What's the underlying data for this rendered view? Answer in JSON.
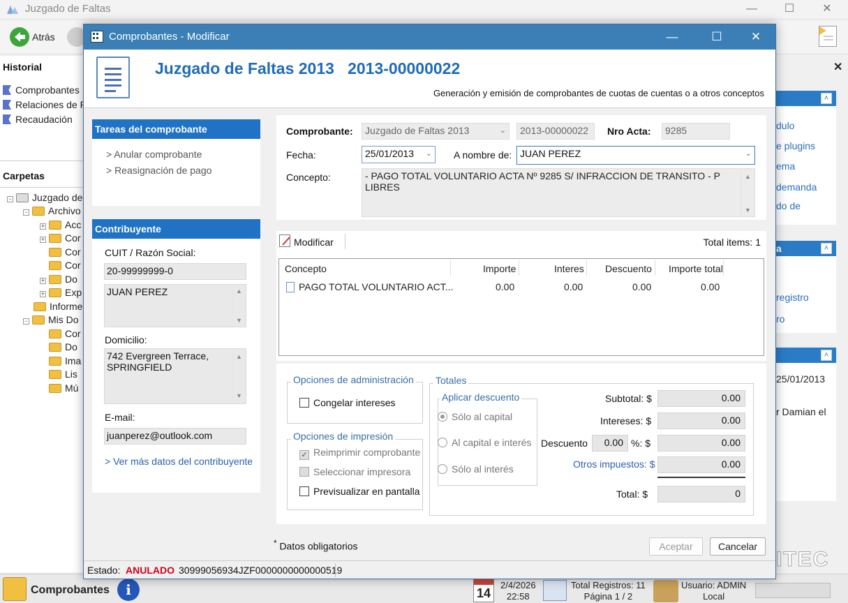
{
  "bg": {
    "title": "Juzgado de Faltas",
    "back_label": "Atrás",
    "historial_heading": "Historial",
    "historial_items": [
      "Comprobantes",
      "Relaciones de P",
      "Recaudación"
    ],
    "carpetas_heading": "Carpetas",
    "tree": [
      "Juzgado de",
      "Archivo",
      "Acc",
      "Cor",
      "Cor",
      "Cor",
      "Do",
      "Exp",
      "Informe",
      "Mis Do",
      "Cor",
      "Do",
      "Ima",
      "Lis",
      "Mú"
    ],
    "right_links_1": [
      "dulo",
      "e plugins",
      "ema",
      "demanda",
      "do de"
    ],
    "right_head_2": "a",
    "right_links_2": [
      "registro",
      "ro"
    ],
    "right_date": "25/01/2013",
    "right_text": "r Damian el",
    "right_brand": "ITEC",
    "status_module": "Comprobantes",
    "status_day": "14",
    "status_date": "2/4/2026",
    "status_time": "22:58",
    "status_total": "Total Registros: 11",
    "status_page": "Página 1 / 2",
    "status_user": "Usuario: ADMIN",
    "status_scope": "Local"
  },
  "dialog": {
    "title": "Comprobantes - Modificar",
    "header_title": "Juzgado de Faltas 2013   2013-00000022",
    "header_subtitle": "Generación y emisión de comprobantes de cuotas de cuentas o a otros conceptos",
    "tareas": {
      "heading": "Tareas del comprobante",
      "items": [
        "> Anular comprobante",
        "> Reasignación de pago"
      ]
    },
    "contribuyente": {
      "heading": "Contribuyente",
      "cuit_label": "CUIT / Razón Social:",
      "cuit_value": "20-99999999-0",
      "name_value": "JUAN PEREZ",
      "domicilio_label": "Domicilio:",
      "domicilio_line1": "742 Evergreen Terrace,",
      "domicilio_line2": "SPRINGFIELD",
      "email_label": "E-mail:",
      "email_value": "juanperez@outlook.com",
      "more_link": "> Ver más datos del contribuyente"
    },
    "form": {
      "comprobante_label": "Comprobante:",
      "comprobante_value": "Juzgado de Faltas 2013",
      "numero_value": "2013-00000022",
      "nro_acta_label": "Nro Acta:",
      "nro_acta_value": "9285",
      "fecha_label": "Fecha:",
      "fecha_value": "25/01/2013",
      "a_nombre_label": "A nombre de:",
      "a_nombre_value": "JUAN PEREZ",
      "concepto_label": "Concepto:",
      "concepto_value": "- PAGO TOTAL VOLUNTARIO ACTA Nº 9285 S/ INFRACCION DE TRANSITO - P LIBRES"
    },
    "items": {
      "modificar_label": "Modificar",
      "total_items": "Total items: 1",
      "columns": [
        "Concepto",
        "Importe",
        "Interes",
        "Descuento",
        "Importe total"
      ],
      "rows": [
        [
          "PAGO TOTAL VOLUNTARIO ACT...",
          "0.00",
          "0.00",
          "0.00",
          "0.00"
        ]
      ]
    },
    "opciones_admin": {
      "title": "Opciones de administración",
      "congelar": "Congelar intereses"
    },
    "opciones_impresion": {
      "title": "Opciones de impresión",
      "reimprimir": "Reimprimir comprobante",
      "seleccionar": "Seleccionar impresora",
      "previsualizar": "Previsualizar en pantalla"
    },
    "totales": {
      "title": "Totales",
      "descuento_group": "Aplicar descuento",
      "radios": [
        "Sólo al capital",
        "Al capital e interés",
        "Sólo al interés"
      ],
      "subtotal_label": "Subtotal: $",
      "subtotal": "0.00",
      "intereses_label": "Intereses: $",
      "intereses": "0.00",
      "descuento_label": "Descuento",
      "descuento_pct": "0.00",
      "pct_label": "%: $",
      "descuento": "0.00",
      "otros_label": "Otros impuestos: $",
      "otros": "0.00",
      "total_label": "Total: $",
      "total": "0"
    },
    "required_note": "Datos obligatorios",
    "aceptar": "Aceptar",
    "cancelar": "Cancelar",
    "estado_label": "Estado:",
    "estado_value": "ANULADO",
    "barcode": "30999056934JZF0000000000000519",
    "colors": {
      "accent": "#1f72c4",
      "title_bar": "#3b7fb6",
      "estado": "#d0021b"
    }
  }
}
